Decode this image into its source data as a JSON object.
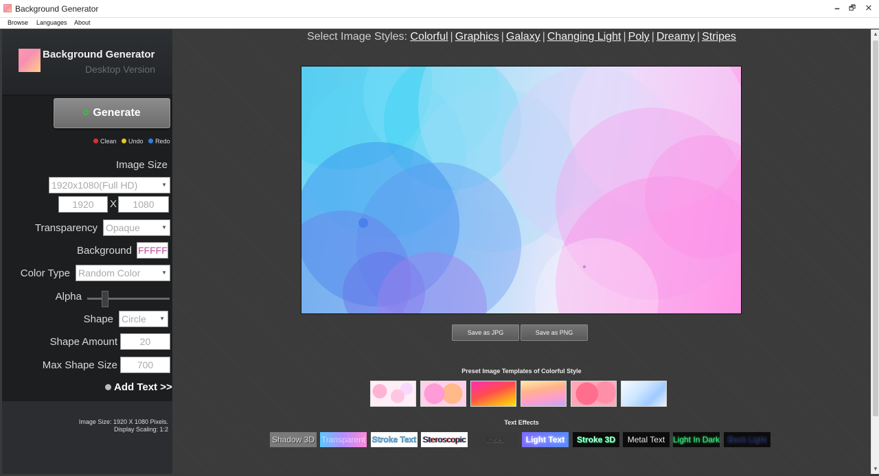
{
  "window": {
    "title": "Background Generator",
    "controls": {
      "minimize": "🗕",
      "maximize": "🗗",
      "close": "✕"
    }
  },
  "menu": [
    "Browse",
    "Languages",
    "About"
  ],
  "sidebar": {
    "app_name": "Background Generator",
    "app_subtitle": "Desktop Version",
    "generate_label": "Generate",
    "actions": {
      "clean": "Clean",
      "undo": "Undo",
      "redo": "Redo"
    },
    "image_size_label": "Image Size",
    "image_size_value": "1920x1080(Full HD)",
    "width_value": "1920",
    "x_sep": "X",
    "height_value": "1080",
    "transparency_label": "Transparency",
    "transparency_value": "Opaque",
    "background_label": "Background",
    "background_value": "FFFFF",
    "color_type_label": "Color Type",
    "color_type_value": "Random Color",
    "alpha_label": "Alpha",
    "alpha_level": 0.22,
    "shape_label": "Shape",
    "shape_value": "Circle",
    "shape_amount_label": "Shape Amount",
    "shape_amount_value": "20",
    "max_shape_size_label": "Max Shape Size",
    "max_shape_size_value": "700",
    "add_text_label": "Add Text >>",
    "info_line1": "Image Size: 1920 X 1080 Pixels.",
    "info_line2": "Display Scaling: 1:2"
  },
  "main": {
    "styles_prefix": "Select Image Styles:",
    "styles": [
      "Colorful",
      "Graphics",
      "Galaxy",
      "Changing Light",
      "Poly",
      "Dreamy",
      "Stripes"
    ],
    "save_jpg": "Save as JPG",
    "save_png": "Save as PNG",
    "preset_title": "Preset Image Templates of Colorful Style",
    "effects_title": "Text Effects",
    "effects": [
      "Shadow 3D",
      "Transparent",
      "Stroke Text",
      "Steroscopic",
      "Inset",
      "Light Text",
      "Stroke 3D",
      "Metal Text",
      "Light In Dark",
      "Back Light"
    ]
  },
  "colors": {
    "generate_dot": "#35c13a",
    "clean_dot": "#e03030",
    "undo_dot": "#e7c81f",
    "redo_dot": "#2f7fe0"
  }
}
